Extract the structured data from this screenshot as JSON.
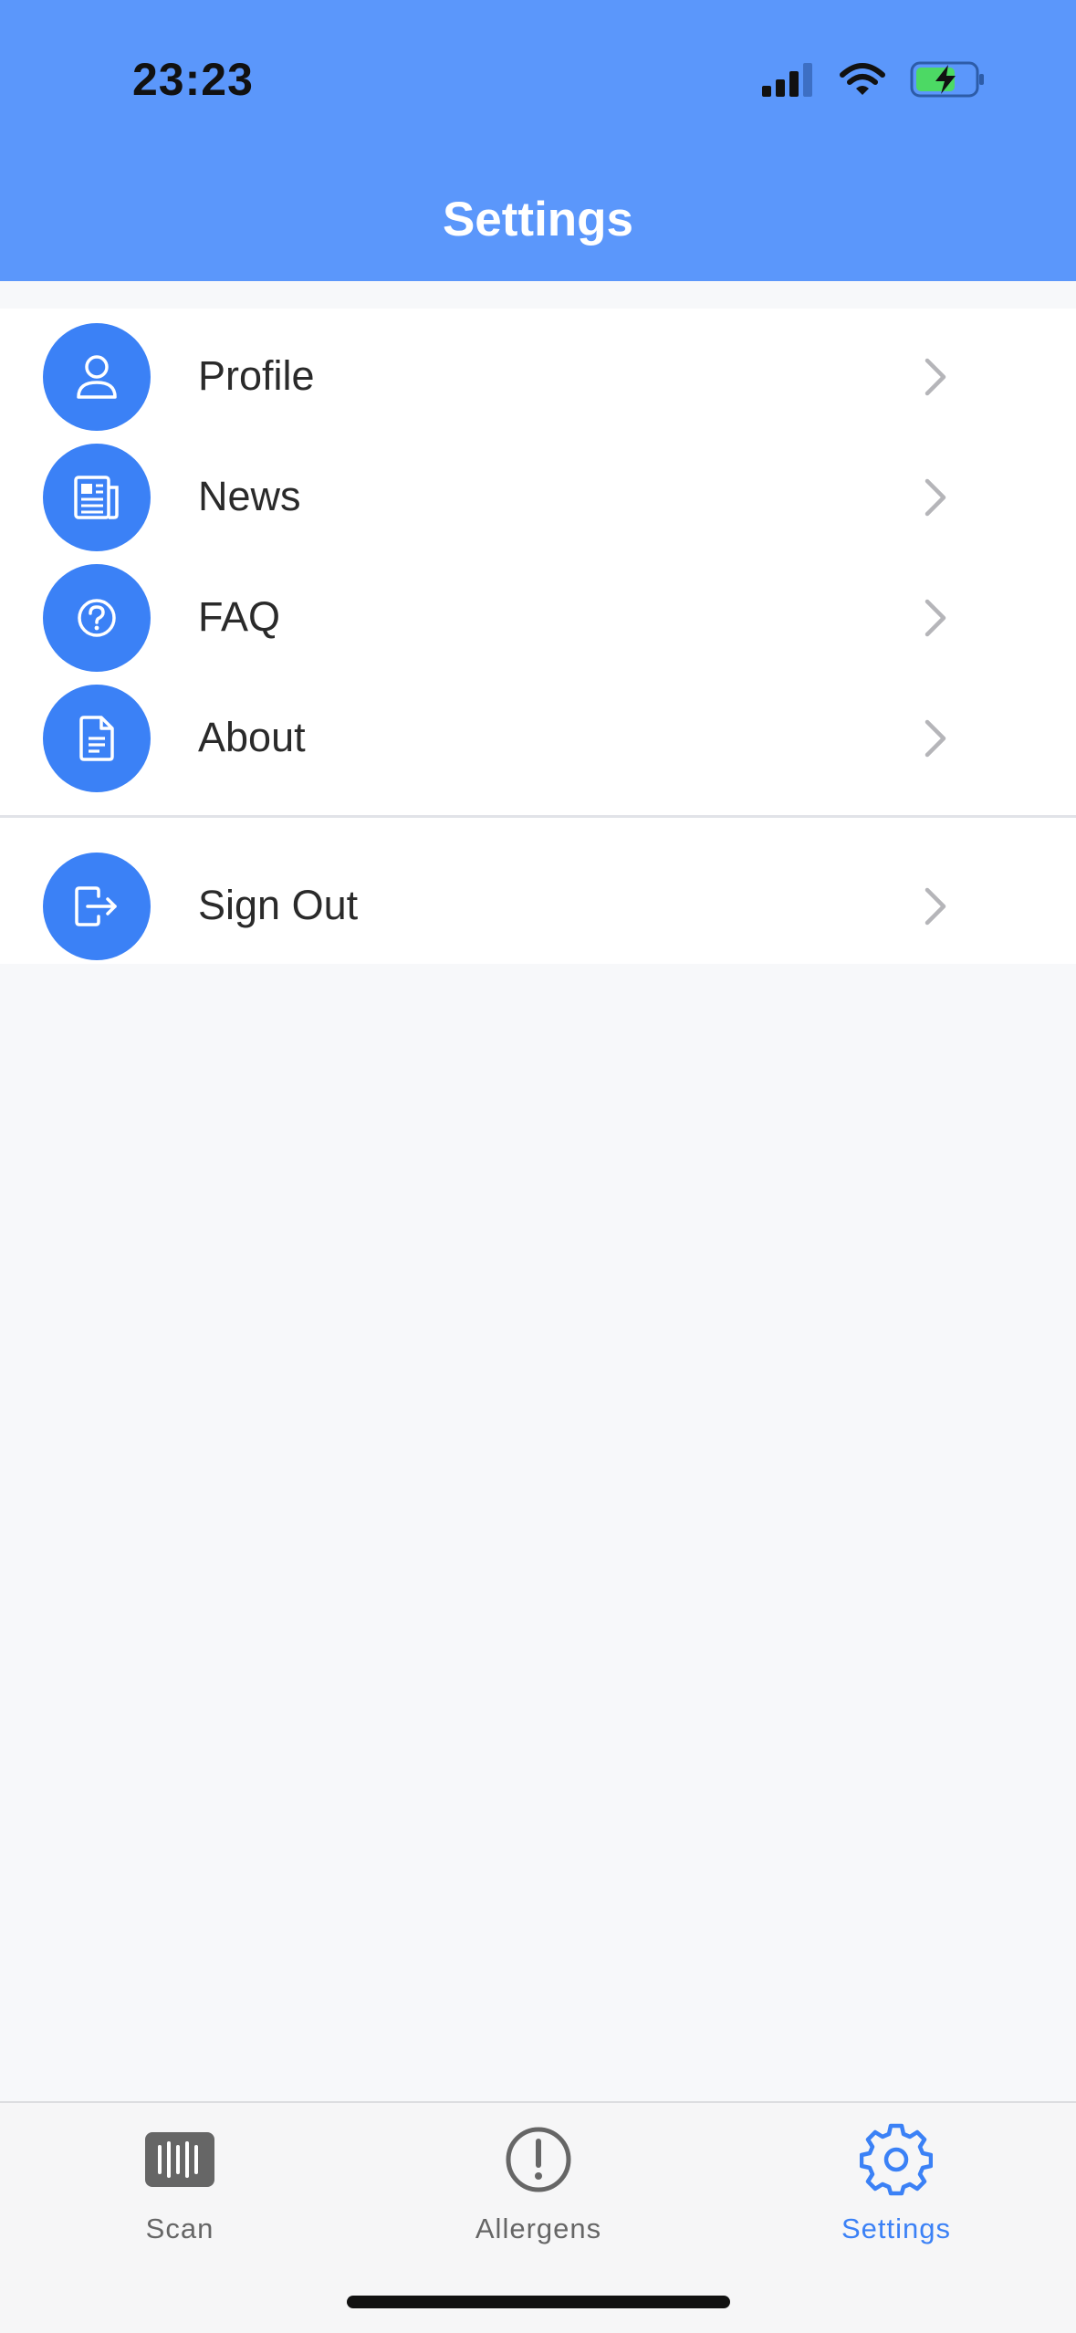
{
  "status_bar": {
    "time": "23:23"
  },
  "header": {
    "title": "Settings"
  },
  "menu": [
    {
      "label": "Profile",
      "icon": "person-icon"
    },
    {
      "label": "News",
      "icon": "newspaper-icon"
    },
    {
      "label": "FAQ",
      "icon": "question-circle-icon"
    },
    {
      "label": "About",
      "icon": "document-icon"
    }
  ],
  "signout": {
    "label": "Sign Out",
    "icon": "sign-out-icon"
  },
  "tabs": [
    {
      "label": "Scan",
      "icon": "barcode-icon",
      "active": false
    },
    {
      "label": "Allergens",
      "icon": "exclamation-circle-icon",
      "active": false
    },
    {
      "label": "Settings",
      "icon": "gear-icon",
      "active": true
    }
  ],
  "colors": {
    "header": "#5b97fb",
    "accent": "#3b81f6",
    "background": "#f7f8fa"
  }
}
